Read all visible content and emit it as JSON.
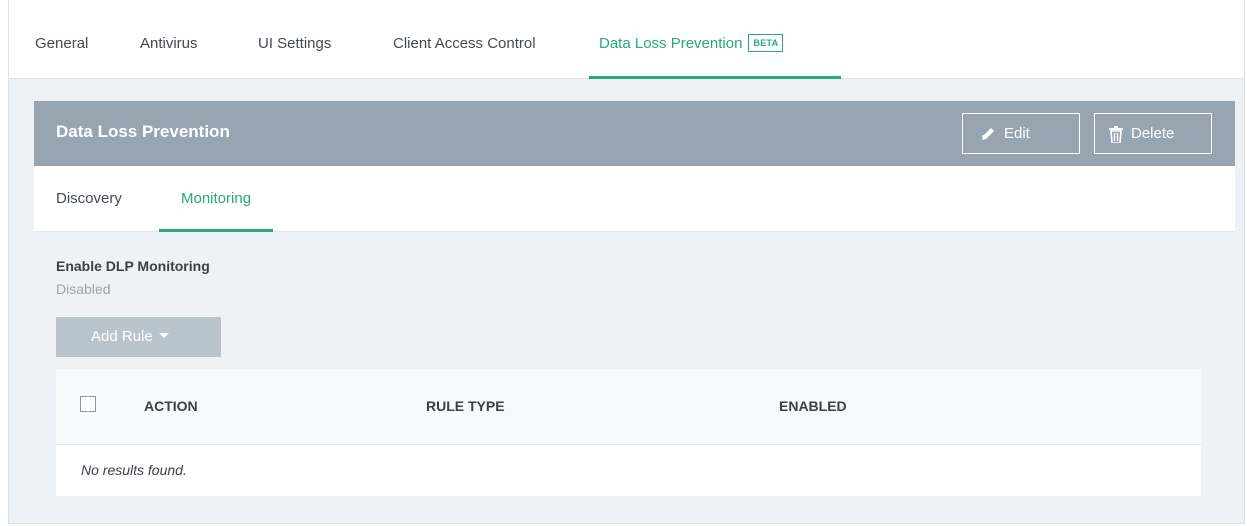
{
  "top_tabs": [
    {
      "label": "General"
    },
    {
      "label": "Antivirus"
    },
    {
      "label": "UI Settings"
    },
    {
      "label": "Client Access Control"
    },
    {
      "label": "Data Loss Prevention",
      "badge": "BETA",
      "active": true
    }
  ],
  "panel": {
    "title": "Data Loss Prevention",
    "edit_label": "Edit",
    "delete_label": "Delete",
    "edit_icon": "edit-pen-icon",
    "delete_icon": "trash-icon"
  },
  "sub_tabs": [
    {
      "label": "Discovery"
    },
    {
      "label": "Monitoring",
      "active": true
    }
  ],
  "setting": {
    "label": "Enable DLP Monitoring",
    "value": "Disabled"
  },
  "add_rule": {
    "label": "Add Rule"
  },
  "table": {
    "columns": [
      "ACTION",
      "RULE TYPE",
      "ENABLED"
    ],
    "empty_message": "No results found."
  },
  "colors": {
    "accent": "#2aa77e",
    "header_bg": "#97a5b3",
    "disabled_button": "#bac4cd",
    "page_bg": "#eef2f6"
  }
}
